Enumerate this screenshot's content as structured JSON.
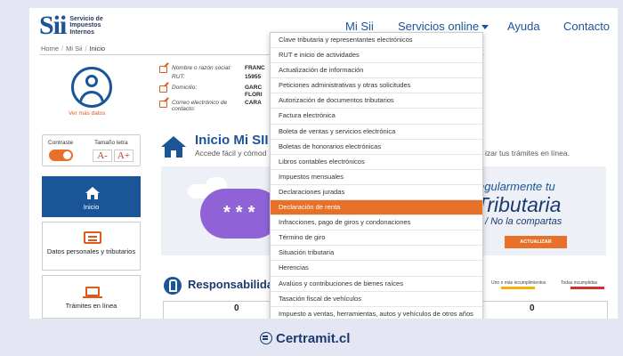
{
  "header": {
    "logo_mark": "Sii",
    "logo_text": "Servicio de Impuestos Internos",
    "nav": [
      "Mi Sii",
      "Servicios online",
      "Ayuda",
      "Contacto"
    ]
  },
  "breadcrumb": [
    "Home",
    "Mi Sii",
    "Inicio"
  ],
  "user": {
    "see_more": "Ver más datos",
    "fields": [
      {
        "label": "Nombre o razón social:",
        "value": "FRANC",
        "editable": true
      },
      {
        "label": "RUT:",
        "value": "15955",
        "editable": false
      },
      {
        "label": "Domicilio:",
        "value": "GARC",
        "value2": "FLORI",
        "editable": true
      },
      {
        "label": "Correo electrónico de contacto:",
        "value": "CARA",
        "editable": true
      }
    ]
  },
  "accessibility": {
    "contrast_label": "Contraste",
    "font_size_label": "Tamaño letra",
    "font_decrease": "A-",
    "font_increase": "A+"
  },
  "side_menu": [
    {
      "label": "Inicio",
      "active": true,
      "icon": "home-icon"
    },
    {
      "label": "Datos personales y tributarios",
      "active": false,
      "icon": "document-icon"
    },
    {
      "label": "Trámites en línea",
      "active": false,
      "icon": "laptop-icon"
    }
  ],
  "main": {
    "title": "Inicio Mi SII",
    "subtitle": "Accede fácil y cómod",
    "subtitle_right": "izar tus trámites en línea."
  },
  "banner": {
    "line1": "egularmente tu",
    "line2": "Tributaria",
    "line3": "/ No la compartas",
    "button": "ACTUALIZAR",
    "stars": "***"
  },
  "responsibilities": {
    "title": "Responsabilida",
    "legend": [
      {
        "label": "Uno o más incumplimientos",
        "color": "#f0b400"
      },
      {
        "label": "Todas incumplidas",
        "color": "#d0312d"
      }
    ],
    "counts": [
      "0",
      "0"
    ]
  },
  "dropdown": {
    "items": [
      "Clave tributaria y representantes electrónicos",
      "RUT e inicio de actividades",
      "Actualización de información",
      "Peticiones administrativas y otras solicitudes",
      "Autorización de documentos tributarios",
      "Factura electrónica",
      "Boleta de ventas y servicios electrónica",
      "Boletas de honorarios electrónicas",
      "Libros contables electrónicos",
      "Impuestos mensuales",
      "Declaraciones juradas",
      "Declaración de renta",
      "Infracciones, pago de giros y condonaciones",
      "Término de giro",
      "Situación tributaria",
      "Herencias",
      "Avalúos y contribuciones de bienes raíces",
      "Tasación fiscal de vehículos",
      "Impuesto a ventas, herramientas, autos y vehículos de otros años"
    ],
    "highlighted": "Declaración de renta"
  },
  "footer": {
    "brand": "Certramit.cl"
  },
  "colors": {
    "primary": "#1a5598",
    "accent": "#e8712a",
    "background": "#e4e7f3"
  }
}
